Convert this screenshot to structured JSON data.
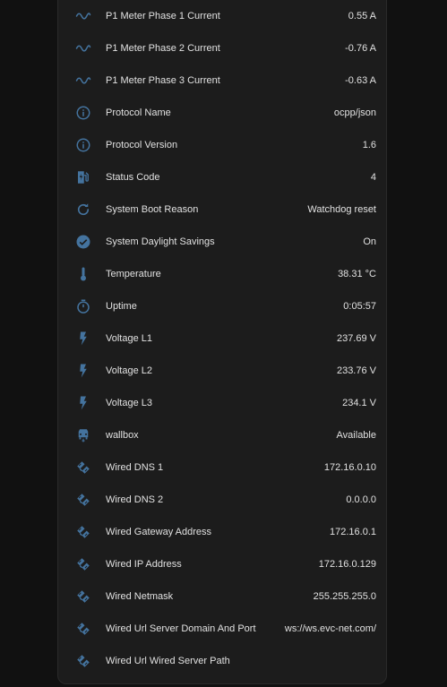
{
  "theme": {
    "background": "#111111",
    "card": "#1c1c1c",
    "icon_color": "#44739e",
    "text": "#e1e1e1"
  },
  "entities": [
    {
      "icon": "sine-wave-icon",
      "label": "P1 Meter Phase 1 Current",
      "value": "0.55 A"
    },
    {
      "icon": "sine-wave-icon",
      "label": "P1 Meter Phase 2 Current",
      "value": "-0.76 A"
    },
    {
      "icon": "sine-wave-icon",
      "label": "P1 Meter Phase 3 Current",
      "value": "-0.63 A"
    },
    {
      "icon": "info-icon",
      "label": "Protocol Name",
      "value": "ocpp/json"
    },
    {
      "icon": "info-icon",
      "label": "Protocol Version",
      "value": "1.6"
    },
    {
      "icon": "ev-station-icon",
      "label": "Status Code",
      "value": "4"
    },
    {
      "icon": "restart-icon",
      "label": "System Boot Reason",
      "value": "Watchdog reset"
    },
    {
      "icon": "check-circle-icon",
      "label": "System Daylight Savings",
      "value": "On"
    },
    {
      "icon": "thermometer-icon",
      "label": "Temperature",
      "value": "38.31 °C"
    },
    {
      "icon": "timer-icon",
      "label": "Uptime",
      "value": "0:05:57"
    },
    {
      "icon": "lightning-bolt-icon",
      "label": "Voltage L1",
      "value": "237.69 V"
    },
    {
      "icon": "lightning-bolt-icon",
      "label": "Voltage L2",
      "value": "233.76 V"
    },
    {
      "icon": "lightning-bolt-icon",
      "label": "Voltage L3",
      "value": "234.1 V"
    },
    {
      "icon": "car-electric-icon",
      "label": "wallbox",
      "value": "Available"
    },
    {
      "icon": "ethernet-icon",
      "label": "Wired DNS 1",
      "value": "172.16.0.10"
    },
    {
      "icon": "ethernet-icon",
      "label": "Wired DNS 2",
      "value": "0.0.0.0"
    },
    {
      "icon": "ethernet-icon",
      "label": "Wired Gateway Address",
      "value": "172.16.0.1"
    },
    {
      "icon": "ethernet-icon",
      "label": "Wired IP Address",
      "value": "172.16.0.129"
    },
    {
      "icon": "ethernet-icon",
      "label": "Wired Netmask",
      "value": "255.255.255.0"
    },
    {
      "icon": "ethernet-icon",
      "label": "Wired Url Server Domain And Port",
      "value": "ws://ws.evc-net.com/"
    },
    {
      "icon": "ethernet-icon",
      "label": "Wired Url Wired Server Path",
      "value": ""
    }
  ]
}
